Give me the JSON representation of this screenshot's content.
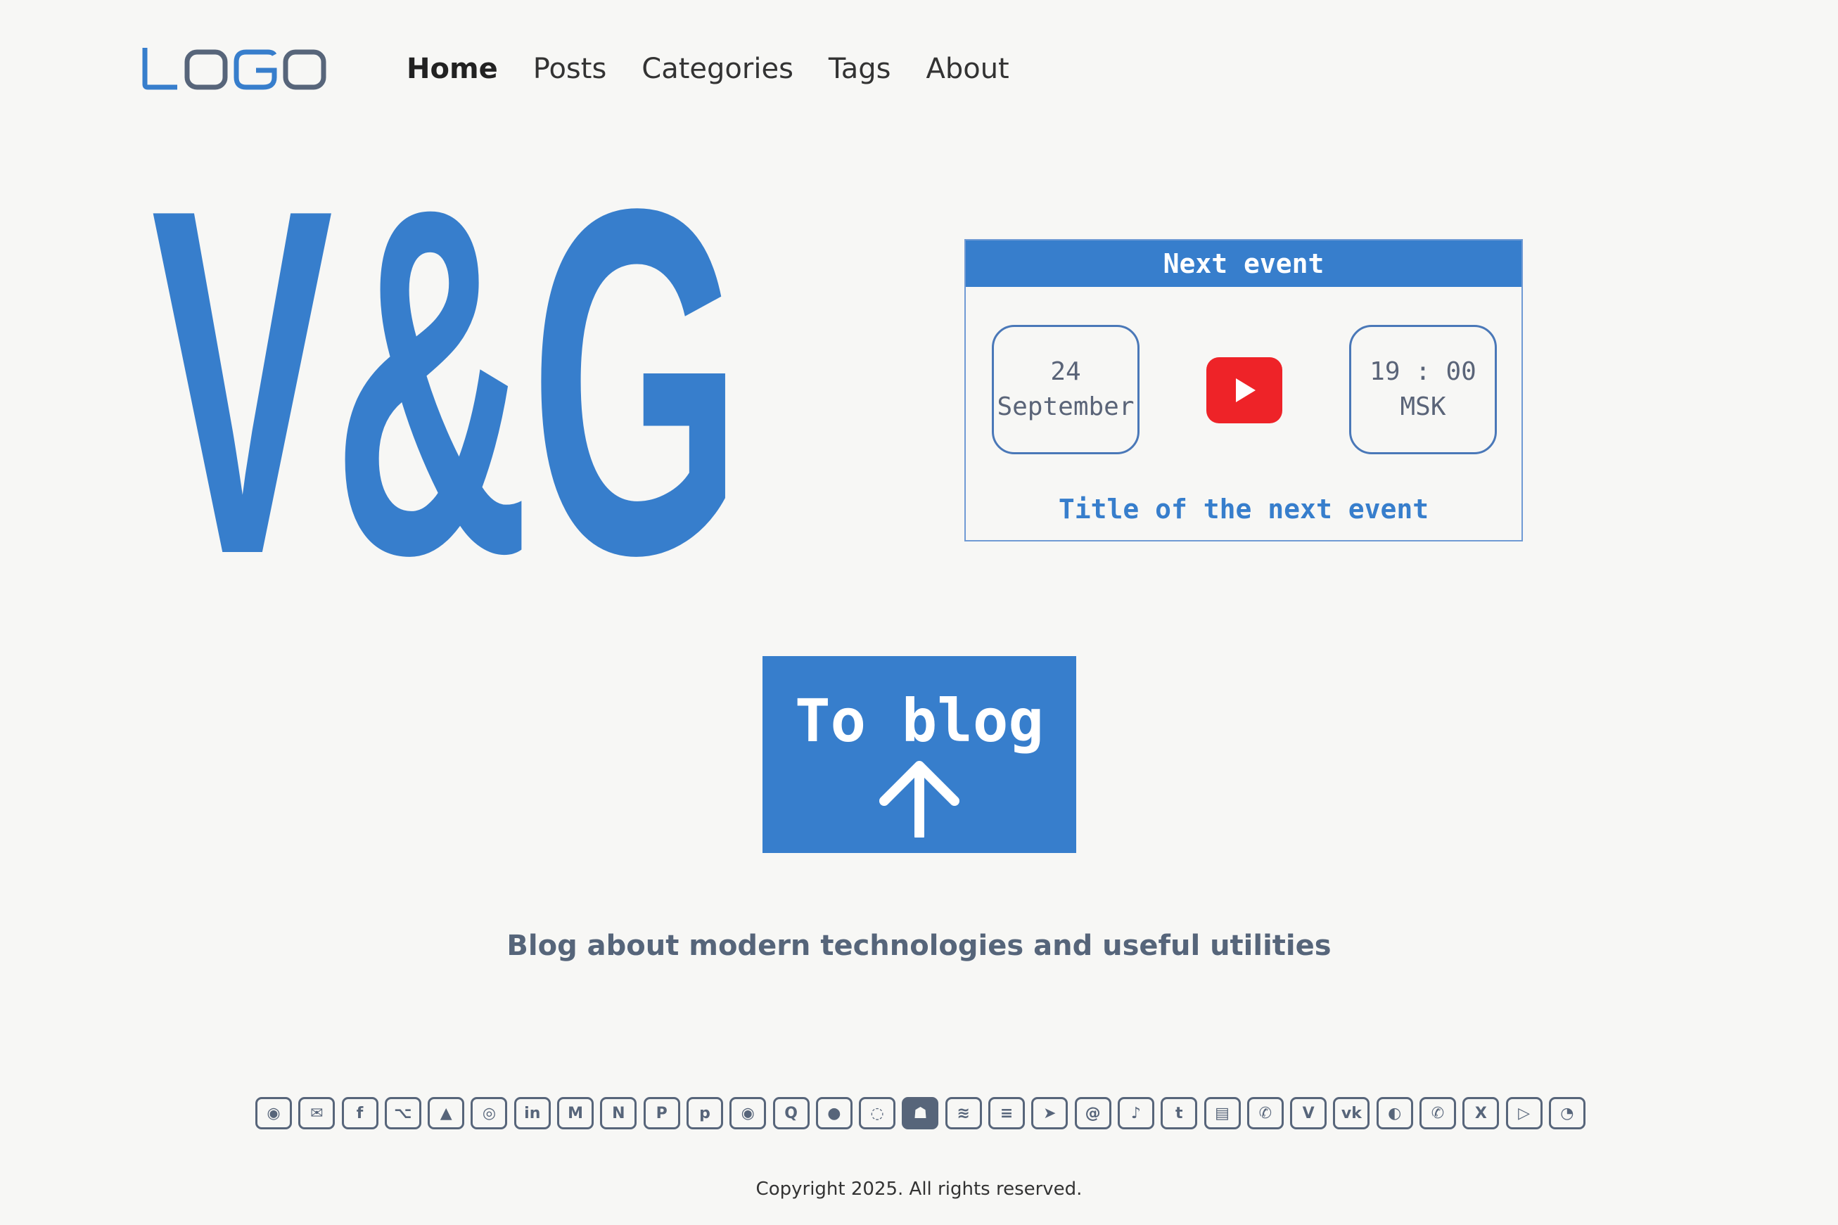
{
  "header": {
    "logo_text": "LOGO",
    "nav": [
      {
        "label": "Home",
        "active": true
      },
      {
        "label": "Posts",
        "active": false
      },
      {
        "label": "Categories",
        "active": false
      },
      {
        "label": "Tags",
        "active": false
      },
      {
        "label": "About",
        "active": false
      }
    ]
  },
  "hero": {
    "title": "V&G"
  },
  "event": {
    "heading": "Next event",
    "day": "24",
    "month": "September",
    "time": "19 : 00",
    "timezone": "MSK",
    "platform_icon": "youtube-icon",
    "title": "Title of the next event"
  },
  "cta": {
    "label": "To blog",
    "icon": "arrow-up-icon"
  },
  "tagline": "Blog about modern technologies and useful utilities",
  "social": [
    {
      "name": "discord",
      "glyph": "◉"
    },
    {
      "name": "email",
      "glyph": "✉"
    },
    {
      "name": "facebook",
      "glyph": "f"
    },
    {
      "name": "github",
      "glyph": "⌥"
    },
    {
      "name": "arc",
      "glyph": "▲"
    },
    {
      "name": "instagram",
      "glyph": "◎"
    },
    {
      "name": "linkedin",
      "glyph": "in"
    },
    {
      "name": "medium",
      "glyph": "M"
    },
    {
      "name": "notion",
      "glyph": "N"
    },
    {
      "name": "paypal",
      "glyph": "P"
    },
    {
      "name": "pinterest",
      "glyph": "p"
    },
    {
      "name": "podcasts",
      "glyph": "◉"
    },
    {
      "name": "quora",
      "glyph": "Q"
    },
    {
      "name": "reddit",
      "glyph": "●"
    },
    {
      "name": "signal",
      "glyph": "◌"
    },
    {
      "name": "snapchat",
      "glyph": "☗"
    },
    {
      "name": "spotify",
      "glyph": "≋"
    },
    {
      "name": "substack",
      "glyph": "≡"
    },
    {
      "name": "telegram",
      "glyph": "➤"
    },
    {
      "name": "threads",
      "glyph": "@"
    },
    {
      "name": "tiktok",
      "glyph": "♪"
    },
    {
      "name": "tumblr",
      "glyph": "t"
    },
    {
      "name": "twitch",
      "glyph": "▤"
    },
    {
      "name": "viber",
      "glyph": "✆"
    },
    {
      "name": "vimeo",
      "glyph": "V"
    },
    {
      "name": "vk",
      "glyph": "vk"
    },
    {
      "name": "wechat",
      "glyph": "◐"
    },
    {
      "name": "whatsapp",
      "glyph": "✆"
    },
    {
      "name": "x",
      "glyph": "X"
    },
    {
      "name": "youtube",
      "glyph": "▷"
    },
    {
      "name": "rss",
      "glyph": "◔"
    }
  ],
  "footer": {
    "copyright": "Copyright 2025. All rights reserved."
  },
  "colors": {
    "accent": "#377ecc",
    "muted": "#57657a",
    "youtube": "#ee2328",
    "background": "#f7f7f5"
  }
}
